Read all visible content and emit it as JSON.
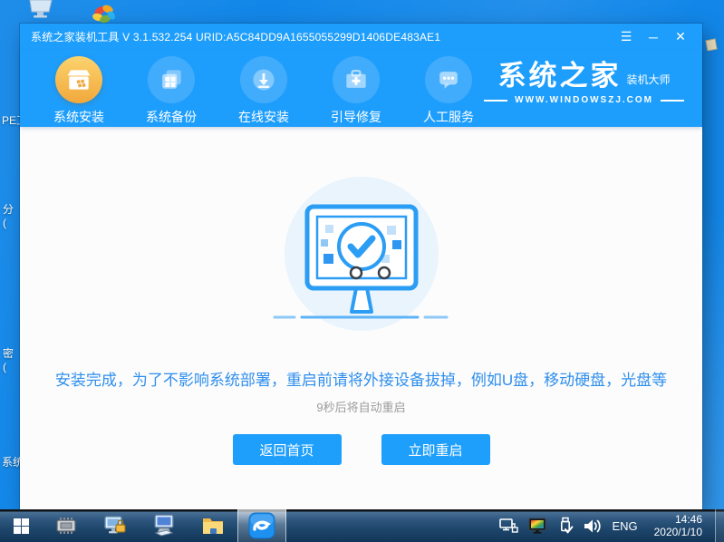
{
  "desktop": {
    "fragments": [
      "PE工",
      "分\n(",
      "密\n(",
      "系统"
    ],
    "top_icons": [
      "display-icon",
      "syszj-flower-logo",
      "bag-icon"
    ]
  },
  "window": {
    "titlebar": {
      "title": "系统之家装机工具 V 3.1.532.254 URID:A5C84DD9A1655055299D1406DE483AE1",
      "menu_icon": "☰",
      "minimize_icon": "─",
      "close_icon": "✕"
    },
    "nav": {
      "items": [
        {
          "label": "系统安装",
          "icon": "package-install-icon",
          "active": true
        },
        {
          "label": "系统备份",
          "icon": "backup-copies-icon",
          "active": false
        },
        {
          "label": "在线安装",
          "icon": "online-download-icon",
          "active": false
        },
        {
          "label": "引导修复",
          "icon": "boot-repair-toolbox-icon",
          "active": false
        },
        {
          "label": "人工服务",
          "icon": "live-support-chat-icon",
          "active": false
        }
      ],
      "logo": {
        "title": "系统之家",
        "subtitle": "装机大师",
        "website": "WWW.WINDOWSZJ.COM"
      }
    },
    "main": {
      "illustration": "monitor-check-success-icon",
      "message": "安装完成，为了不影响系统部署，重启前请将外接设备拔掉，例如U盘，移动硬盘，光盘等",
      "countdown": "9秒后将自动重启",
      "buttons": [
        {
          "label": "返回首页"
        },
        {
          "label": "立即重启"
        }
      ]
    }
  },
  "taskbar": {
    "icons": [
      "start-icon",
      "memory-chip-icon",
      "pc-lock-icon",
      "pc-keyboard-icon",
      "folder-icon",
      "installer-app-icon",
      "network-icon",
      "display-color-icon",
      "usb-eject-icon",
      "volume-icon"
    ],
    "tray": {
      "language": "ENG",
      "time": "14:46",
      "date": "2020/1/10"
    }
  },
  "colors": {
    "accent_blue": "#1e9efc",
    "active_gold": "#f5b544",
    "desktop_blue": "#1287e9",
    "message_blue": "#2f8fee"
  }
}
